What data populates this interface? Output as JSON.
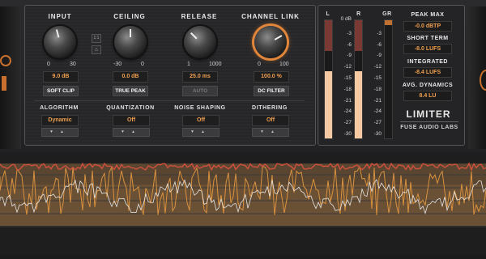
{
  "controls": {
    "input": {
      "title": "INPUT",
      "min": "0",
      "max": "30",
      "value": "9.0 dB",
      "button": "SOFT CLIP"
    },
    "ceiling": {
      "title": "CEILING",
      "min": "-30",
      "max": "0",
      "value": "0.0 dB",
      "button": "TRUE PEAK"
    },
    "release": {
      "title": "RELEASE",
      "min": "1",
      "max": "1000",
      "value": "25.0 ms",
      "button": "AUTO"
    },
    "channel_link": {
      "title": "CHANNEL LINK",
      "min": "0",
      "max": "100",
      "value": "100.0 %",
      "button": "DC FILTER"
    }
  },
  "link_buttons": [
    "1:1",
    "△"
  ],
  "selectors": {
    "algorithm": {
      "title": "ALGORITHM",
      "value": "Dynamic"
    },
    "quantization": {
      "title": "QUANTIZATION",
      "value": "Off"
    },
    "noise_shaping": {
      "title": "NOISE SHAPING",
      "value": "Off"
    },
    "dithering": {
      "title": "DITHERING",
      "value": "Off"
    }
  },
  "meters": {
    "labels": {
      "left": "L",
      "right": "R",
      "gr": "GR"
    },
    "scale_top": "0 dB",
    "scale": [
      "-3",
      "-6",
      "-9",
      "-12",
      "-15",
      "-18",
      "-21",
      "-24",
      "-27",
      "-30"
    ],
    "left_level": 0.57,
    "right_level": 0.57
  },
  "readouts": {
    "peak_max": {
      "label": "PEAK MAX",
      "value": "-0.0 dBTP"
    },
    "short_term": {
      "label": "SHORT TERM",
      "value": "-8.0 LUFS"
    },
    "integrated": {
      "label": "INTEGRATED",
      "value": "-8.4 LUFS"
    },
    "avg_dynamics": {
      "label": "AVG. DYNAMICS",
      "value": "8.4 LU"
    }
  },
  "brand": {
    "product": "LIMITER",
    "company": "FUSE AUDIO LABS"
  },
  "colors": {
    "accent": "#f0a050",
    "meter_fill": "#f4c9a3",
    "meter_red": "#8a3a32"
  }
}
